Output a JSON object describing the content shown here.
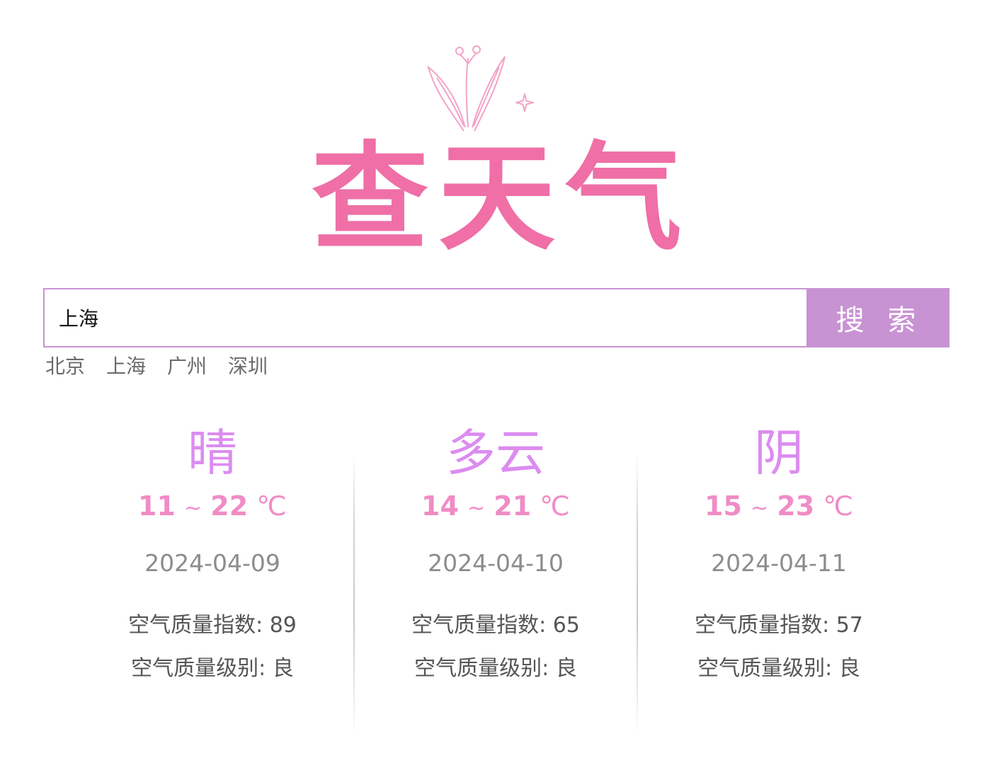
{
  "logo": {
    "text": "查天气",
    "color": "#ef6fa6",
    "icon": "flower-sprout-icon"
  },
  "search": {
    "value": "上海",
    "button_label": "搜 索",
    "border_color": "#c993d3",
    "button_color": "#c893d2"
  },
  "quick_cities": [
    "北京",
    "上海",
    "广州",
    "深圳"
  ],
  "forecast": [
    {
      "weather": "晴",
      "low": "11",
      "sep": "~",
      "high": "22",
      "unit": "℃",
      "date": "2024-04-09",
      "aqi_label": "空气质量指数: 89",
      "level_label": "空气质量级别: 良"
    },
    {
      "weather": "多云",
      "low": "14",
      "sep": "~",
      "high": "21",
      "unit": "℃",
      "date": "2024-04-10",
      "aqi_label": "空气质量指数: 65",
      "level_label": "空气质量级别: 良"
    },
    {
      "weather": "阴",
      "low": "15",
      "sep": "~",
      "high": "23",
      "unit": "℃",
      "date": "2024-04-11",
      "aqi_label": "空气质量指数: 57",
      "level_label": "空气质量级别: 良"
    }
  ],
  "colors": {
    "weather_text": "#dc8cf0",
    "temperature_text": "#f08cc6",
    "date_text": "#8c8c8c",
    "aqi_text": "#555555"
  }
}
